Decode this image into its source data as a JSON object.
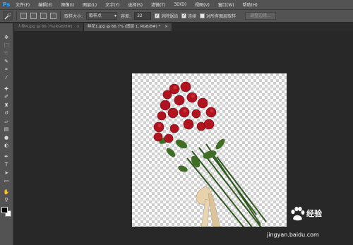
{
  "app": {
    "logo": "Ps",
    "accent": "#31a8ff"
  },
  "menu": [
    "文件(F)",
    "编辑(E)",
    "图像(I)",
    "图层(L)",
    "文字(Y)",
    "选择(S)",
    "滤镜(T)",
    "3D(D)",
    "视图(V)",
    "窗口(W)",
    "帮助(H)"
  ],
  "options": {
    "tool_icon": "quick-selection-icon",
    "sample_size_label": "取样大小:",
    "sample_size_value": "取样点",
    "tolerance_label": "容差:",
    "tolerance_value": "32",
    "antialias_label": "消除锯齿",
    "antialias_checked": true,
    "contiguous_label": "连续",
    "contiguous_checked": true,
    "all_layers_label": "对所有图层取样",
    "all_layers_checked": false,
    "refine_edge_label": "调整边缘..."
  },
  "tabs": [
    {
      "label": "人物4.jpg @ 66.7%(RGB/8#)",
      "close": "×",
      "active": false
    },
    {
      "label": "鲜花1.jpg @ 66.7% (图层 1, RGB/8#) *",
      "close": "×",
      "active": true
    }
  ],
  "watermark": {
    "brand": "经验",
    "url": "jingyan.baidu.com"
  }
}
